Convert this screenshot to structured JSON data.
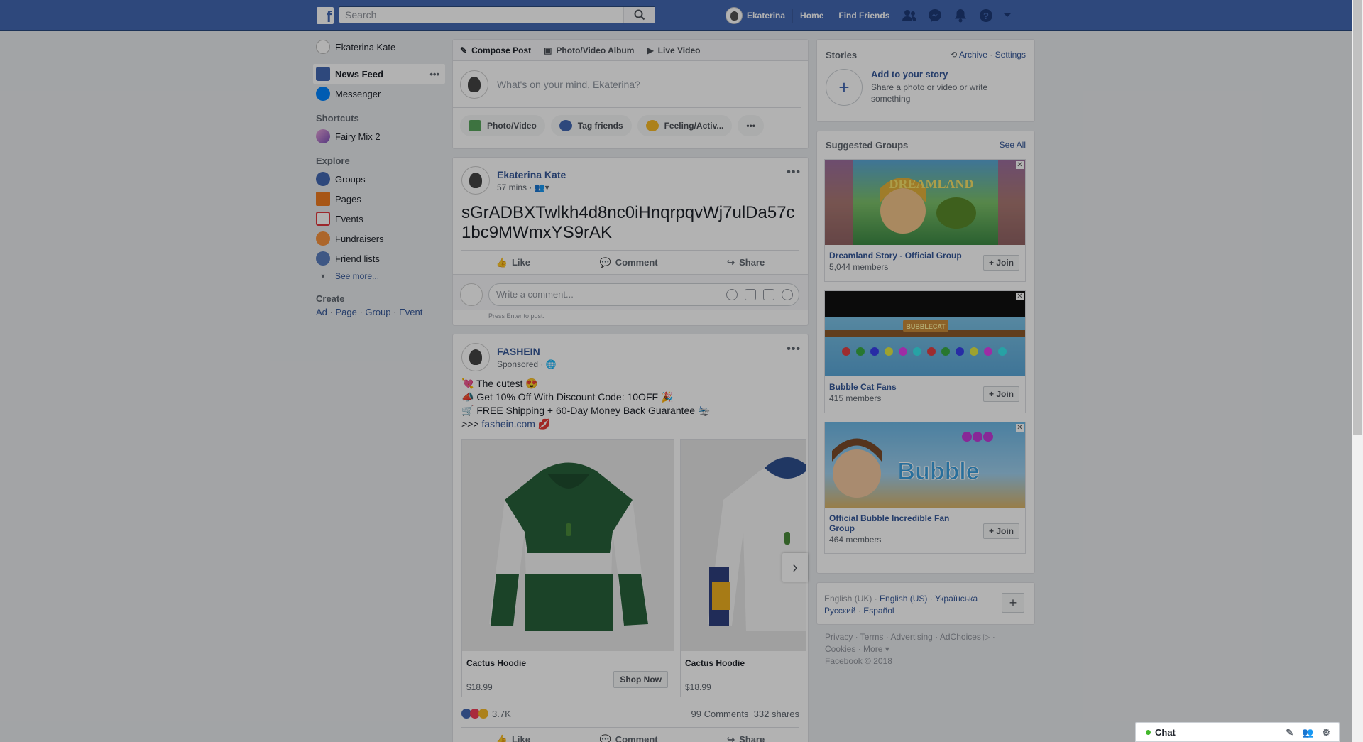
{
  "topbar": {
    "search_placeholder": "Search",
    "user_name": "Ekaterina",
    "home": "Home",
    "find_friends": "Find Friends"
  },
  "left_nav": {
    "profile_name": "Ekaterina Kate",
    "news_feed": "News Feed",
    "messenger": "Messenger",
    "shortcuts_title": "Shortcuts",
    "shortcut_item": "Fairy Mix 2",
    "explore_title": "Explore",
    "explore_items": [
      "Groups",
      "Pages",
      "Events",
      "Fundraisers",
      "Friend lists"
    ],
    "see_more": "See more...",
    "create_title": "Create",
    "create_links": [
      "Ad",
      "Page",
      "Group",
      "Event"
    ]
  },
  "composer": {
    "tabs": [
      "Compose Post",
      "Photo/Video Album",
      "Live Video"
    ],
    "placeholder": "What's on your mind, Ekaterina?",
    "pills": [
      "Photo/Video",
      "Tag friends",
      "Feeling/Activ..."
    ]
  },
  "post1": {
    "author": "Ekaterina Kate",
    "time": "57 mins ·",
    "text": "sGrADBXTwlkh4d8nc0iHnqrpqvWj7ulDa57c1bc9MWmxYS9rAK",
    "like": "Like",
    "comment": "Comment",
    "share": "Share",
    "comment_placeholder": "Write a comment...",
    "press_enter": "Press Enter to post."
  },
  "post2": {
    "author": "FASHEIN",
    "meta": "Sponsored ·",
    "line1": "💘 The cutest 😍",
    "line2": "📣 Get 10% Off With Discount Code: 10OFF 🎉",
    "line3": "🛒 FREE Shipping + 60-Day Money Back Guarantee 🛬",
    "line4_prefix": ">>> ",
    "line4_link": "fashein.com",
    "line4_suffix": " 💋",
    "products": [
      {
        "title": "Cactus Hoodie",
        "price": "$18.99",
        "cta": "Shop Now"
      },
      {
        "title": "Cactus Hoodie",
        "price": "$18.99"
      }
    ],
    "reactions_count": "3.7K",
    "comments_count": "99 Comments",
    "shares_count": "332 shares",
    "like": "Like",
    "comment": "Comment",
    "share": "Share"
  },
  "stories": {
    "title": "Stories",
    "archive": "Archive",
    "settings": "Settings",
    "add_title": "Add to your story",
    "add_desc": "Share a photo or video or write something"
  },
  "suggested_groups": {
    "title": "Suggested Groups",
    "see_all": "See All",
    "join": "+ Join",
    "groups": [
      {
        "name": "Dreamland Story - Official Group",
        "members": "5,044 members"
      },
      {
        "name": "Bubble Cat Fans",
        "members": "415 members"
      },
      {
        "name": "Official Bubble Incredible Fan Group",
        "members": "464 members"
      }
    ]
  },
  "languages": {
    "items": [
      "English (UK)",
      "English (US)",
      "Українська",
      "Русский",
      "Español"
    ]
  },
  "footer": {
    "links": [
      "Privacy",
      "Terms",
      "Advertising",
      "AdChoices",
      "Cookies",
      "More"
    ],
    "copyright": "Facebook © 2018"
  },
  "chat": {
    "label": "Chat"
  },
  "colors": {
    "brand": "#4267b2",
    "link": "#365899",
    "background": "#e9ebee"
  }
}
